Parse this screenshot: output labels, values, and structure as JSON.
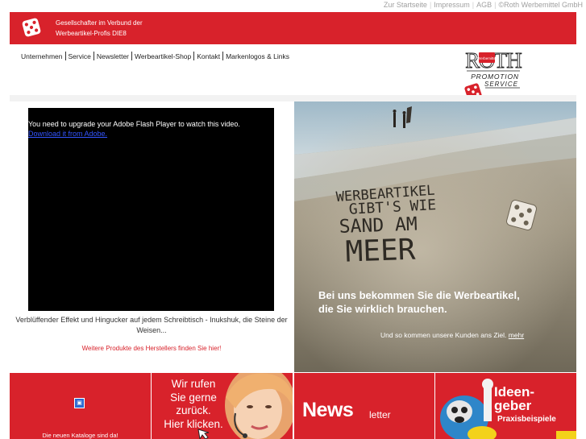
{
  "top_links": [
    "Zur Startseite",
    "Impressum",
    "AGB",
    "©Roth Werbemittel GmbH"
  ],
  "header": {
    "tagline_line1": "Gesellschafter im Verbund der",
    "tagline_line2": "Werbeartikel-Profis DIE8"
  },
  "nav": {
    "items": [
      "Unternehmen",
      "Service",
      "Newsletter",
      "Werbeartikel-Shop",
      "Kontakt",
      "Markenlogos & Links"
    ]
  },
  "logo": {
    "name": "ROTH",
    "badge": "Werbemittel",
    "line1": "PROMOTION",
    "line2": "SERVICE"
  },
  "video": {
    "message": "You need to upgrade your Adobe Flash Player to watch this video.",
    "download_link": "Download it from Adobe."
  },
  "product": {
    "caption": "Verblüffender Effekt und Hingucker auf jedem Schreibtisch - Inukshuk, die Steine der Weisen...",
    "link": "Weitere Produkte des Herstellers finden Sie hier!"
  },
  "hero": {
    "sand_line1": "WERBEARTIKEL",
    "sand_line2": "GIBT'S WIE",
    "sand_line3": "SAND AM",
    "sand_line4": "MEER",
    "headline_line1": "Bei uns bekommen Sie die Werbeartikel,",
    "headline_line2": "die Sie wirklich brauchen.",
    "sub": "Und so kommen unsere Kunden ans Ziel.",
    "more": "mehr"
  },
  "tiles": {
    "catalog": "Die neuen Kataloge sind da!",
    "callback_lines": [
      "Wir rufen",
      "Sie gerne",
      "zurück.",
      "Hier klicken."
    ],
    "news_big": "News",
    "news_small": "letter",
    "ideas_line1": "Ideen-",
    "ideas_line2": "geber",
    "ideas_sub": "Praxisbeispiele"
  },
  "colors": {
    "brand_red": "#d8222b",
    "link_blue": "#3355ff"
  }
}
